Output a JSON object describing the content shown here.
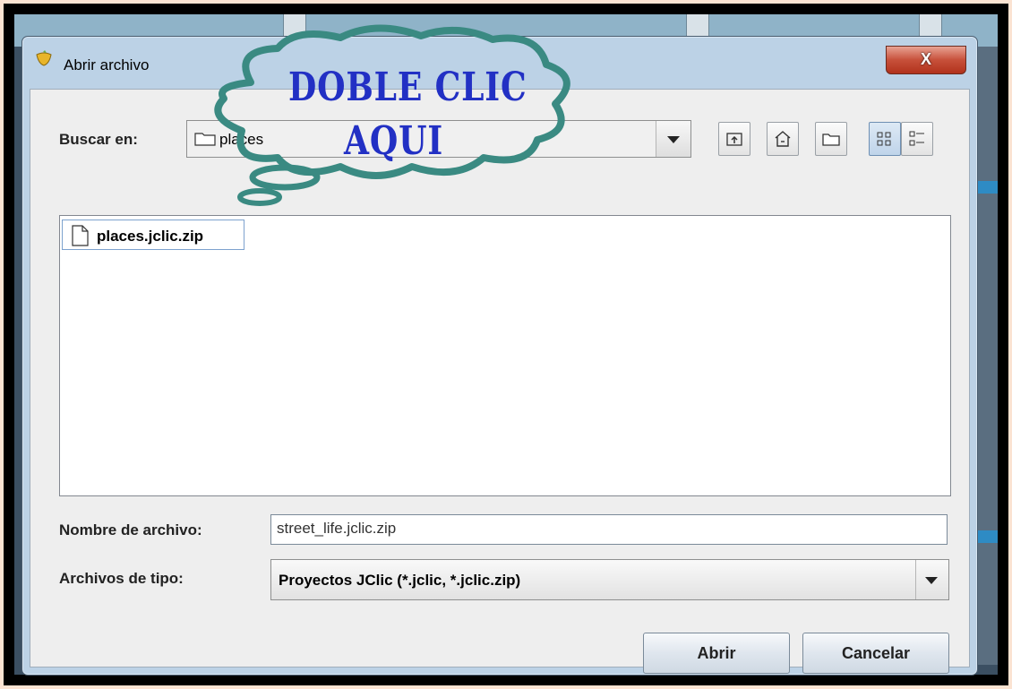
{
  "dialog": {
    "title": "Abrir archivo",
    "close_label": "X"
  },
  "lookin": {
    "label": "Buscar en:",
    "value": "places"
  },
  "toolbar": {
    "icons": [
      "up-folder-icon",
      "home-icon",
      "new-folder-icon",
      "list-view-icon",
      "details-view-icon"
    ]
  },
  "files": [
    {
      "name": "places.jclic.zip",
      "icon": "file-icon"
    }
  ],
  "filename": {
    "label": "Nombre de archivo:",
    "value": "street_life.jclic.zip"
  },
  "filetype": {
    "label": "Archivos de tipo:",
    "value": "Proyectos JClic (*.jclic, *.jclic.zip)"
  },
  "buttons": {
    "open": "Abrir",
    "cancel": "Cancelar"
  },
  "annotation": {
    "line1": "DOBLE CLIC",
    "line2": "AQUI",
    "text_color": "#2230c4",
    "outline_color": "#3a8a82"
  }
}
